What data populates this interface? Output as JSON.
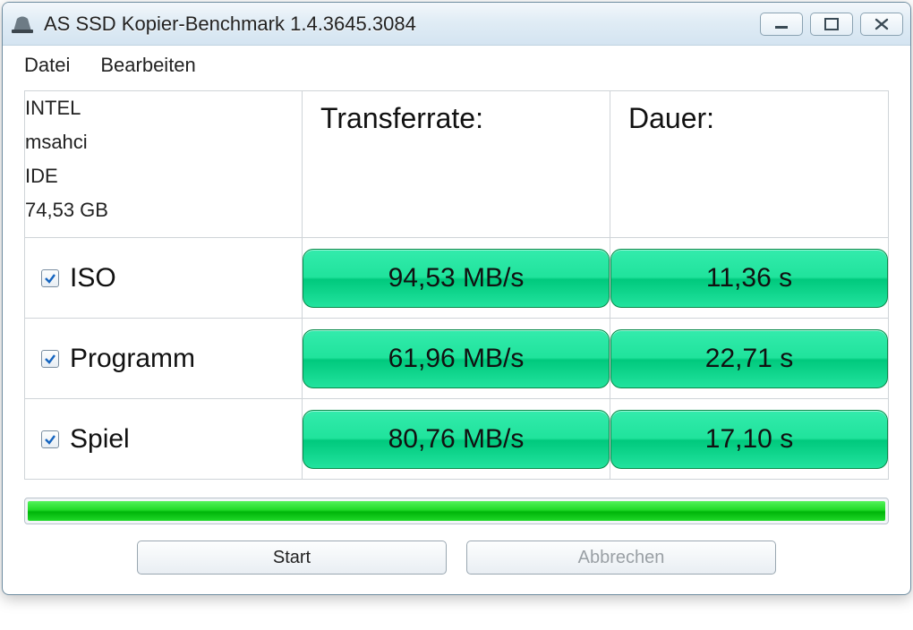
{
  "window_title": "AS SSD Kopier-Benchmark 1.4.3645.3084",
  "menu": {
    "file": "Datei",
    "edit": "Bearbeiten"
  },
  "drive_info": {
    "vendor": "INTEL",
    "driver": "msahci",
    "mode": "IDE",
    "capacity": "74,53 GB"
  },
  "headers": {
    "transfer_rate": "Transferrate:",
    "duration": "Dauer:"
  },
  "rows": {
    "iso": {
      "label": "ISO",
      "rate": "94,53 MB/s",
      "duration": "11,36 s"
    },
    "programm": {
      "label": "Programm",
      "rate": "61,96 MB/s",
      "duration": "22,71 s"
    },
    "spiel": {
      "label": "Spiel",
      "rate": "80,76 MB/s",
      "duration": "17,10 s"
    }
  },
  "buttons": {
    "start": "Start",
    "cancel": "Abbrechen"
  }
}
